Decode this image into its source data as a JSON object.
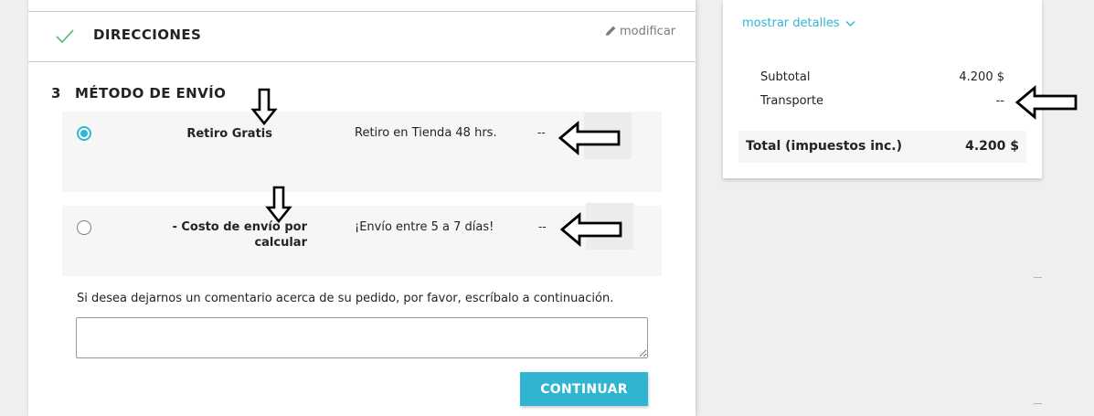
{
  "addresses_step": {
    "title": "DIRECCIONES",
    "edit_label": "modificar",
    "status_icon": "checkmark-icon",
    "status_color": "#4cbb6c"
  },
  "shipping_step": {
    "number": "3",
    "title": "MÉTODO DE ENVÍO",
    "carriers": [
      {
        "name": "Retiro Gratis",
        "delay": "Retiro en Tienda 48 hrs.",
        "price": "--",
        "selected": true
      },
      {
        "name": "- Costo de envío por calcular",
        "delay": "¡Envío entre 5 a 7 días!",
        "price": "--",
        "selected": false
      }
    ],
    "comment_label": "Si desea dejarnos un comentario acerca de su pedido, por favor, escríbalo a continuación.",
    "comment_value": "",
    "continue_label": "CONTINUAR"
  },
  "cart_summary": {
    "show_details_label": "mostrar detalles",
    "subtotal_label": "Subtotal",
    "subtotal_value": "4.200 $",
    "shipping_label": "Transporte",
    "shipping_value": "--",
    "total_label": "Total (impuestos inc.)",
    "total_value": "4.200 $"
  },
  "colors": {
    "accent": "#2fb5d2",
    "row_background": "#f6f6f6",
    "page_background": "#efefef",
    "check_green": "#4cbb6c"
  }
}
